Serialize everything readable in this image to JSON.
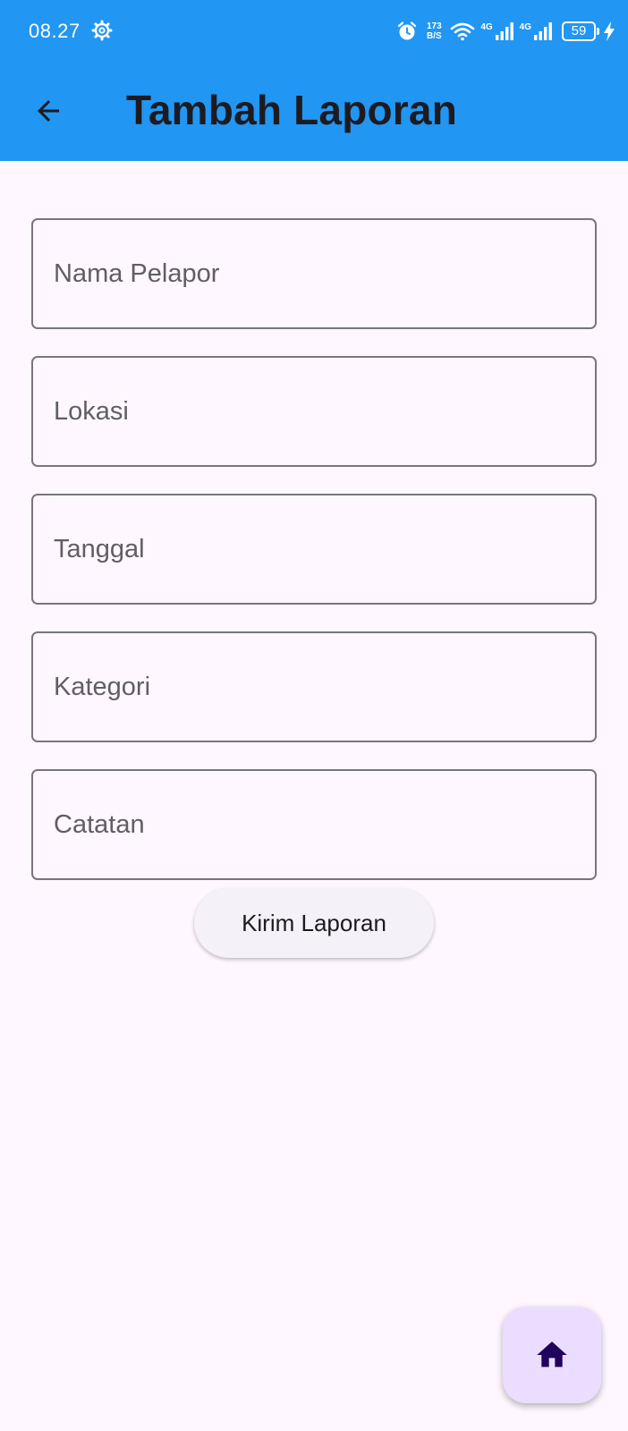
{
  "status_bar": {
    "time": "08.27",
    "speed_value": "173",
    "speed_unit": "B/S",
    "network_1": "4G",
    "network_2": "4G",
    "battery": "59"
  },
  "app_bar": {
    "title": "Tambah Laporan",
    "background_color": "#2196f3"
  },
  "form": {
    "fields": [
      {
        "label": "Nama Pelapor",
        "value": ""
      },
      {
        "label": "Lokasi",
        "value": ""
      },
      {
        "label": "Tanggal",
        "value": ""
      },
      {
        "label": "Kategori",
        "value": ""
      },
      {
        "label": "Catatan",
        "value": ""
      }
    ],
    "submit_label": "Kirim Laporan"
  },
  "fab": {
    "icon": "home-icon",
    "background_color": "#eaddff"
  }
}
